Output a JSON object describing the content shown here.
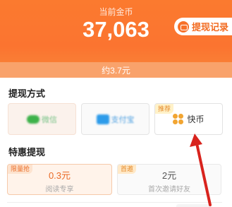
{
  "header": {
    "coin_label": "当前金币",
    "coin_value": "37,063",
    "withdraw_record": "提现记录",
    "approx_amount": "约3.7元"
  },
  "withdraw_methods": {
    "title": "提现方式",
    "items": [
      {
        "label": "微信",
        "icon": "wechat-icon"
      },
      {
        "label": "支付宝",
        "icon": "alipay-icon"
      },
      {
        "label": "快币",
        "icon": "kuaibi-icon",
        "badge": "推荐"
      }
    ]
  },
  "special_offers": {
    "title": "特惠提现",
    "items": [
      {
        "badge": "限量抢",
        "amount": "0.3元",
        "subtitle": "阅读专享"
      },
      {
        "badge": "首邀",
        "amount": "2元",
        "subtitle": "首次邀请好友"
      }
    ]
  },
  "colors": {
    "brand_orange": "#fb7a2f",
    "annotation_red": "#d8231d"
  }
}
